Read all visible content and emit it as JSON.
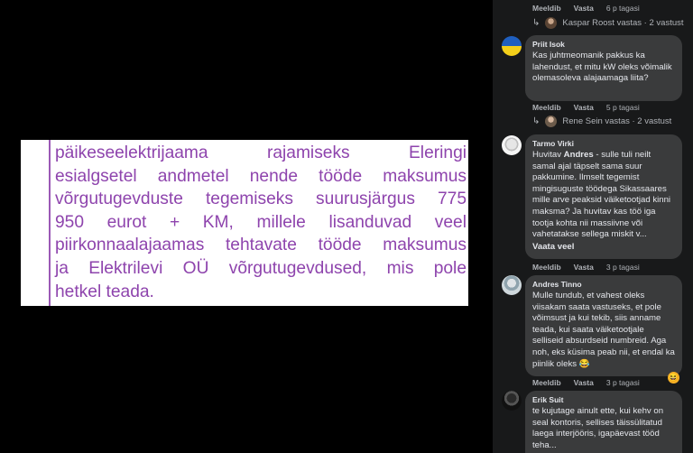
{
  "document": {
    "lines": [
      "päikeseelektrijaama rajamiseks Eleringi",
      "esialgsetel andmetel nende tööde maksumus",
      "võrgutugevduste tegemiseks suurusjärgus 775",
      "950 eurot + KM, millele lisanduvad veel",
      "piirkonnaalajaamas tehtavate tööde maksumus",
      "ja Elektrilevi OÜ võrgutugevdused, mis pole",
      "hetkel teada."
    ]
  },
  "comments": {
    "top_actions": {
      "like": "Meeldib",
      "reply": "Vasta",
      "time": "6 p tagasi"
    },
    "top_replies": "Kaspar Roost vastas · 2 vastust",
    "c1": {
      "author": "Priit Isok",
      "text": "Kas juhtmeomanik pakkus ka lahendust, et mitu kW oleks võimalik olemasoleva alajaamaga liita?",
      "like": "Meeldib",
      "reply": "Vasta",
      "time": "5 p tagasi",
      "replies": "Rene Sein vastas · 2 vastust"
    },
    "c2": {
      "author": "Tarmo Virki",
      "text_before": "Huvitav ",
      "tag": "Andres",
      "text_after": " - sulle tuli neilt samal ajal täpselt sama suur pakkumine. Ilmselt tegemist mingisuguste töödega Sikassaares mille arve peaksid väiketootjad kinni maksma? Ja huvitav kas töö iga tootja kohta nii massiivne või vahetatakse sellega miskit v...",
      "see_more": "Vaata veel",
      "like": "Meeldib",
      "reply": "Vasta",
      "time": "3 p tagasi"
    },
    "c3": {
      "author": "Andres Tinno",
      "text": "Mulle tundub, et vahest oleks viisakam saata vastuseks, et pole võimsust ja kui tekib, siis anname teada, kui saata väiketootjale selliseid absurdseid numbreid. Aga noh, eks küsima peab nii, et endal ka piinlik oleks 😂",
      "reaction_emoji": "😆",
      "like": "Meeldib",
      "reply": "Vasta",
      "time": "3 p tagasi"
    },
    "c4": {
      "author": "Erik Suit",
      "text": "te kujutage ainult ette, kui kehv on seal kontoris, sellises täissülitatud laega interjööris, igapäevast tööd teha..."
    }
  },
  "colors": {
    "panel_bg": "#18191a",
    "bubble_bg": "#3a3b3c",
    "doc_text": "#8e44ad",
    "secondary_text": "#b0b3b8"
  },
  "icons": [
    "reply-arrow-icon",
    "haha-reaction-icon"
  ]
}
